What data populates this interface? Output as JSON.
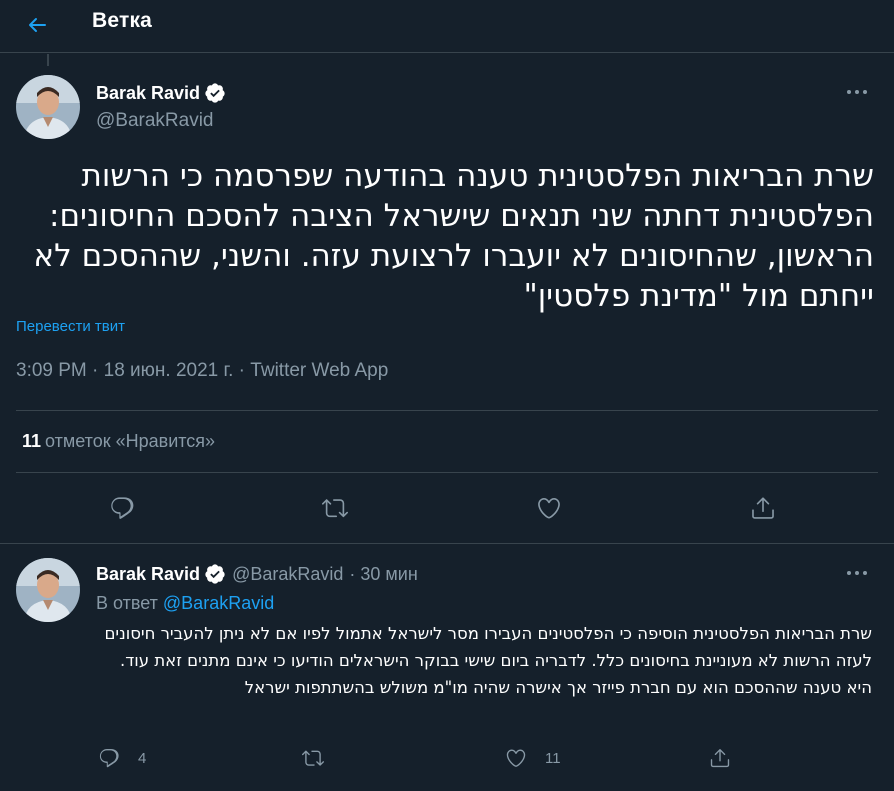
{
  "header": {
    "title": "Ветка",
    "back_icon": "arrow-left-icon"
  },
  "tweet": {
    "author_name": "Barak Ravid",
    "handle": "@BarakRavid",
    "verified": true,
    "text": "שרת הבריאות הפלסטינית טענה בהודעה שפרסמה כי הרשות הפלסטינית דחתה שני תנאים שישראל הציבה להסכם החיסונים: הראשון, שהחיסונים לא יועברו לרצועת עזה. והשני, שההסכם לא ייחתם מול \"מדינת פלסטין\"",
    "translate_label": "Перевести твит",
    "meta": "3:09 PM · 18 июн. 2021 г. · Twitter Web App",
    "likes_count": "11",
    "likes_label": "отметок «Нравится»"
  },
  "reply": {
    "author_name": "Barak Ravid",
    "handle": "@BarakRavid",
    "time": "· 30 мин",
    "reply_prefix": "В ответ",
    "reply_mention": "@BarakRavid",
    "text": "שרת הבריאות הפלסטינית הוסיפה כי הפלסטינים העבירו מסר לישראל אתמול לפיו אם לא ניתן להעביר חיסונים לעזה הרשות לא מעוניינת בחיסונים כלל. לדבריה ביום שישי בבוקר הישראלים הודיעו כי אינם מתנים זאת עוד. היא טענה שההסכם הוא עם חברת פייזר אך אישרה שהיה מו\"מ משולש בהשתתפות ישראל",
    "reply_count": "4",
    "like_count": "11"
  },
  "colors": {
    "background": "#15202b",
    "accent": "#1da1f2",
    "secondary_text": "#8899a6",
    "border": "#38444d"
  }
}
